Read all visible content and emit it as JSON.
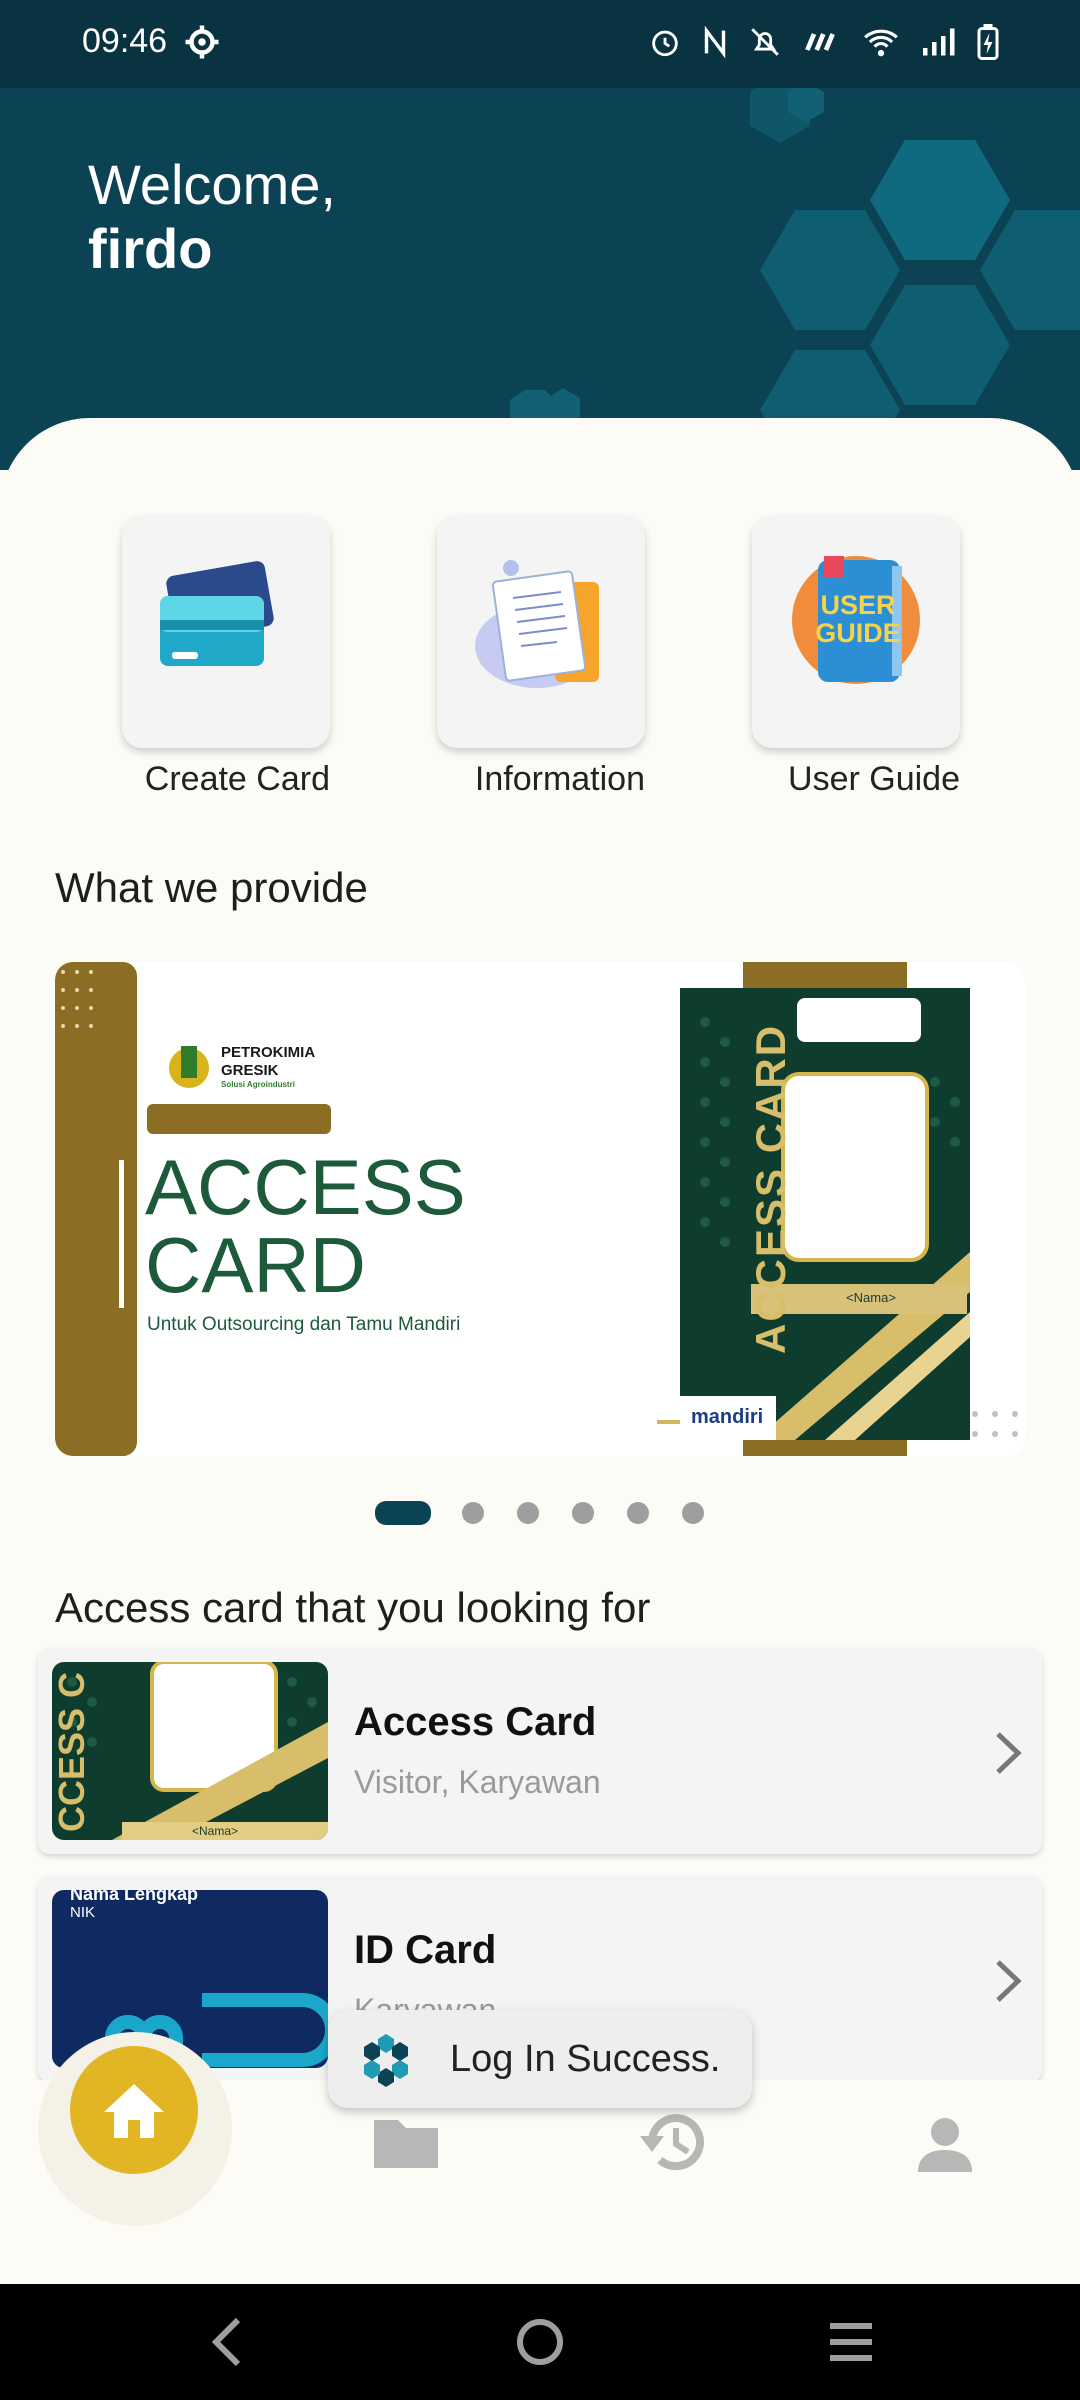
{
  "status_bar": {
    "time": "09:46",
    "icons": [
      "gear-icon",
      "alarm-icon",
      "nfc-icon",
      "mute-icon",
      "speed-icon",
      "wifi-icon",
      "signal-icon",
      "battery-charging-icon"
    ]
  },
  "header": {
    "greeting": "Welcome,",
    "username": "firdo"
  },
  "menu": [
    {
      "label": "Create Card",
      "icon": "credit-card-icon"
    },
    {
      "label": "Information",
      "icon": "documents-icon"
    },
    {
      "label": "User Guide",
      "icon": "user-guide-book-icon"
    }
  ],
  "provide": {
    "title": "What we provide",
    "banner": {
      "company_line1": "PETROKIMIA",
      "company_line2": "GRESIK",
      "company_tagline": "Solusi Agroindustri",
      "title_line1": "ACCESS",
      "title_line2": "CARD",
      "subtitle": "Untuk Outsourcing dan Tamu Mandiri",
      "card_vertical_text": "ACCESS CARD",
      "card_name_placeholder": "<Nama>",
      "bank": "mandiri"
    },
    "pagination": {
      "count": 6,
      "active": 0
    }
  },
  "looking_for": {
    "title": "Access card that you looking for",
    "items": [
      {
        "title": "Access Card",
        "subtitle": "Visitor, Karyawan",
        "thumb_text": "CCESS C",
        "thumb_name": "<Nama>"
      },
      {
        "title": "ID Card",
        "subtitle": "Karyawan",
        "thumb_name": "Nama Lengkap",
        "thumb_nik": "NIK"
      }
    ]
  },
  "toast": {
    "message": "Log In Success."
  },
  "bottom_nav": [
    {
      "name": "home",
      "icon": "home-icon",
      "active": true
    },
    {
      "name": "documents",
      "icon": "folder-icon",
      "active": false
    },
    {
      "name": "history",
      "icon": "history-icon",
      "active": false
    },
    {
      "name": "profile",
      "icon": "person-icon",
      "active": false
    }
  ],
  "colors": {
    "header": "#0c4354",
    "accent": "#e2b524",
    "banner_gold": "#8b6d24",
    "banner_green": "#1c5a3a"
  }
}
